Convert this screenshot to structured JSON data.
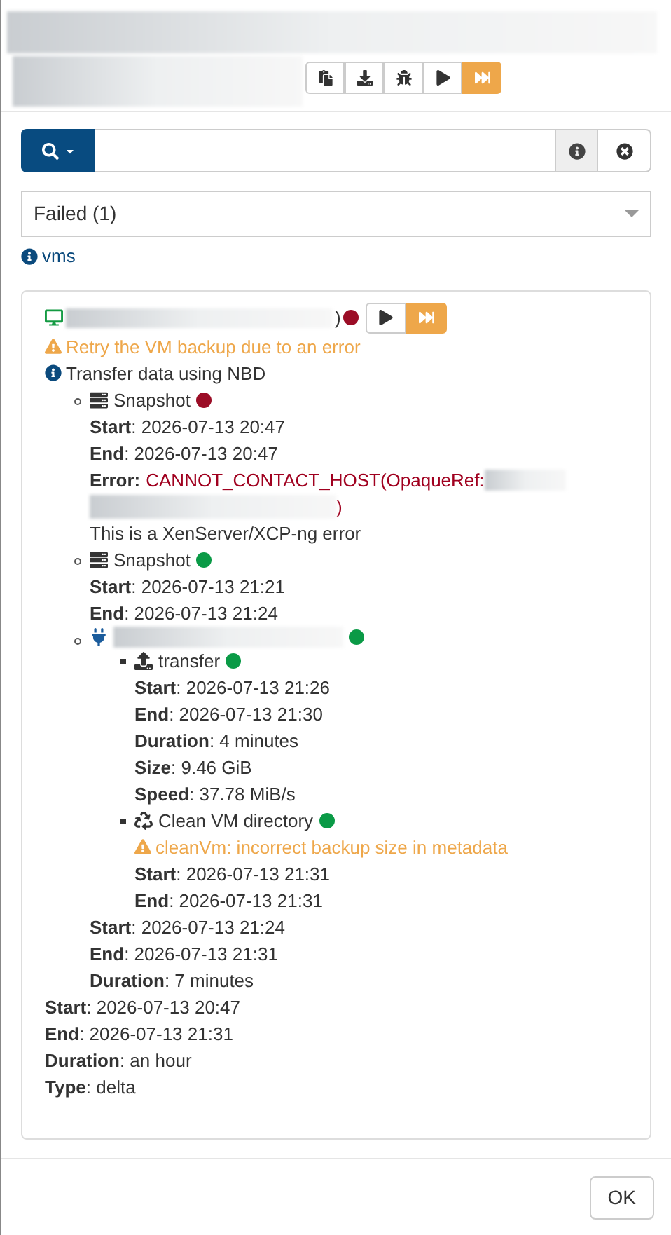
{
  "header": {
    "toolbar": [
      {
        "kind": "copy",
        "primary": false
      },
      {
        "kind": "download",
        "primary": false
      },
      {
        "kind": "bug",
        "primary": false
      },
      {
        "kind": "play",
        "primary": false
      },
      {
        "kind": "fast-forward",
        "primary": true
      }
    ]
  },
  "filter": {
    "value": "Failed (1)"
  },
  "link": "vms",
  "task": {
    "name_tail": ")",
    "color": "#9b0d26",
    "buttons": [
      {
        "kind": "play",
        "primary": false
      },
      {
        "kind": "fast-forward",
        "primary": true
      }
    ],
    "messages": [
      {
        "kind": "warning",
        "text": "Retry the VM backup due to an error"
      },
      {
        "kind": "info",
        "text": "Transfer data using NBD"
      }
    ],
    "children": [
      {
        "kind": "snapshot",
        "title": "Snapshot",
        "color": "#9b0d26",
        "fields": [
          "**Start**: 2026-07-13 20:47",
          "**End**: 2026-07-13 20:47"
        ],
        "error": {
          "label": "Error:",
          "value": "CANNOT_CONTACT_HOST(OpaqueRef:",
          "tail": ")",
          "note": "This is a XenServer/XCP-ng error"
        }
      },
      {
        "kind": "snapshot",
        "title": "Snapshot",
        "color": "#0a9a46",
        "fields": [
          "**Start**: 2026-07-13 21:21",
          "**End**: 2026-07-13 21:24"
        ]
      },
      {
        "kind": "remote",
        "color": "#0a9a46",
        "children": [
          {
            "kind": "transfer",
            "title": "transfer",
            "color": "#0a9a46",
            "fields": [
              "**Start**: 2026-07-13 21:26",
              "**End**: 2026-07-13 21:30",
              "**Duration**: 4 minutes",
              "**Size**: 9.46 GiB",
              "**Speed**: 37.78 MiB/s"
            ]
          },
          {
            "kind": "clean",
            "title": "Clean VM directory",
            "color": "#0a9a46",
            "messages": [
              {
                "kind": "warning",
                "text": "cleanVm: incorrect backup size in metadata"
              }
            ],
            "fields": [
              "**Start**: 2026-07-13 21:31",
              "**End**: 2026-07-13 21:31"
            ]
          }
        ],
        "fields": [
          "**Start**: 2026-07-13 21:24",
          "**End**: 2026-07-13 21:31",
          "**Duration**: 7 minutes"
        ]
      }
    ],
    "fields": [
      "**Start**: 2026-07-13 20:47",
      "**End**: 2026-07-13 21:31",
      "**Duration**: an hour",
      "**Type**: delta"
    ]
  },
  "ok_button": "OK"
}
